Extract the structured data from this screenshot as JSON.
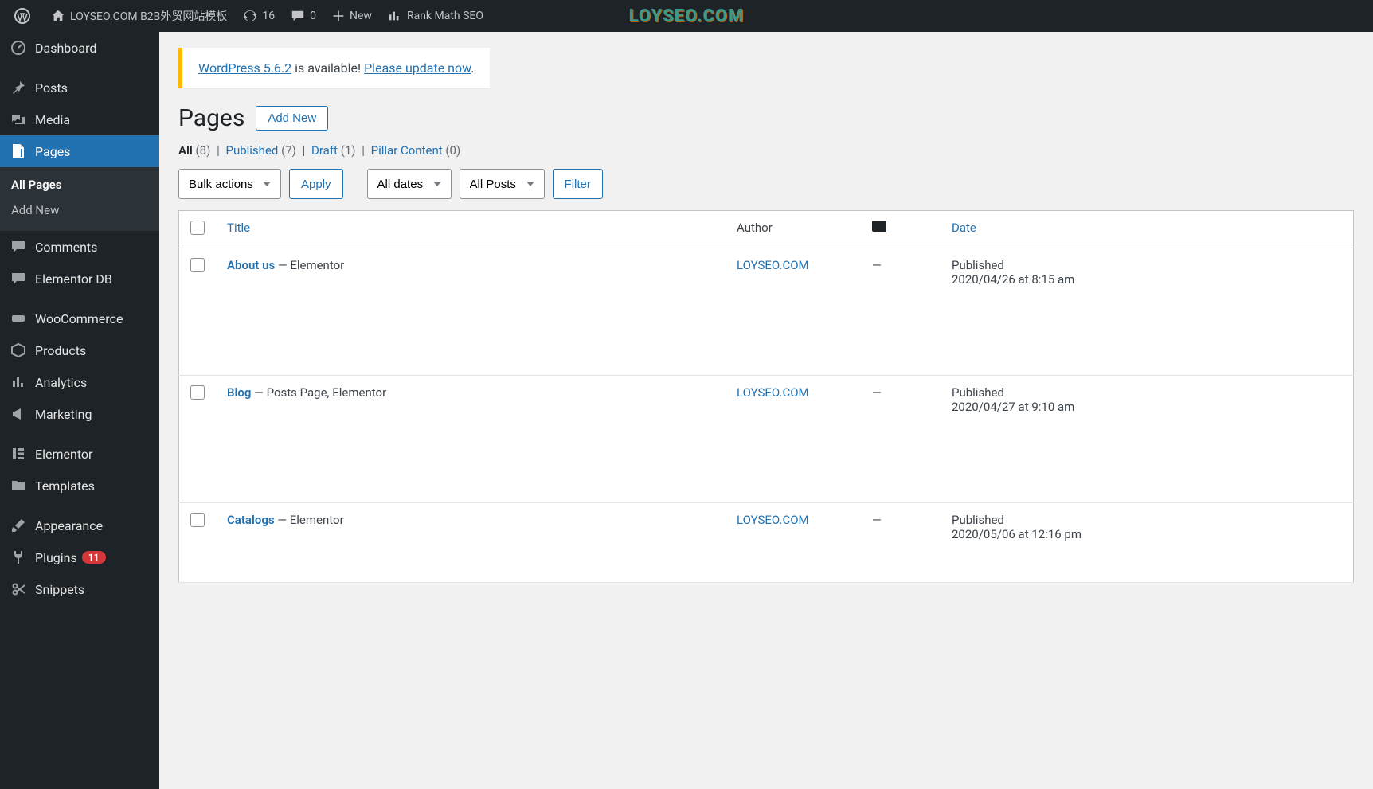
{
  "adminbar": {
    "site_title": "LOYSEO.COM B2B外贸网站模板",
    "updates_count": "16",
    "comments_count": "0",
    "new_label": "New",
    "rank_math_label": "Rank Math SEO",
    "watermark": "LOYSEO.COM"
  },
  "sidebar": {
    "dashboard": "Dashboard",
    "posts": "Posts",
    "media": "Media",
    "pages": "Pages",
    "pages_sub": {
      "all": "All Pages",
      "add": "Add New"
    },
    "comments": "Comments",
    "elementor_db": "Elementor DB",
    "woocommerce": "WooCommerce",
    "products": "Products",
    "analytics": "Analytics",
    "marketing": "Marketing",
    "elementor": "Elementor",
    "templates": "Templates",
    "appearance": "Appearance",
    "plugins": "Plugins",
    "plugins_badge": "11",
    "snippets": "Snippets"
  },
  "notice": {
    "link1": "WordPress 5.6.2",
    "text_mid": " is available! ",
    "link2": "Please update now",
    "period": "."
  },
  "heading": {
    "title": "Pages",
    "add_new": "Add New"
  },
  "filters": {
    "all_label": "All",
    "all_count": "(8)",
    "published_label": "Published",
    "published_count": "(7)",
    "draft_label": "Draft",
    "draft_count": "(1)",
    "pillar_label": "Pillar Content",
    "pillar_count": "(0)"
  },
  "controls": {
    "bulk": "Bulk actions",
    "apply": "Apply",
    "dates": "All dates",
    "posts_filter": "All Posts",
    "filter": "Filter"
  },
  "table": {
    "col_title": "Title",
    "col_author": "Author",
    "col_date": "Date",
    "rows": [
      {
        "title": "About us",
        "meta": " — Elementor",
        "author": "LOYSEO.COM",
        "comments": "—",
        "status": "Published",
        "date": "2020/04/26 at 8:15 am"
      },
      {
        "title": "Blog",
        "meta": " — Posts Page, Elementor",
        "author": "LOYSEO.COM",
        "comments": "—",
        "status": "Published",
        "date": "2020/04/27 at 9:10 am"
      },
      {
        "title": "Catalogs",
        "meta": " — Elementor",
        "author": "LOYSEO.COM",
        "comments": "—",
        "status": "Published",
        "date": "2020/05/06 at 12:16 pm"
      }
    ]
  }
}
